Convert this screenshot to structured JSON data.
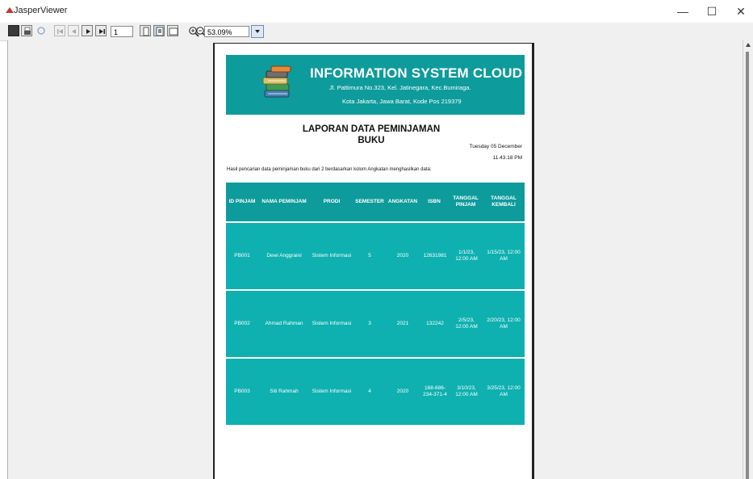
{
  "window": {
    "title": "JasperViewer",
    "minimize_glyph": "—",
    "maximize_glyph": "☐",
    "close_glyph": "✕"
  },
  "toolbar": {
    "page_number": "1",
    "zoom_value": "53.09%",
    "icons": [
      "save-icon",
      "print-icon",
      "reload-icon",
      "first-page-icon",
      "previous-page-icon",
      "next-page-icon",
      "last-page-icon",
      "actual-size-icon",
      "fit-page-icon",
      "fit-width-icon",
      "zoom-in-icon",
      "zoom-out-icon",
      "zoom-dropdown-icon"
    ]
  },
  "report": {
    "company": "INFORMATION SYSTEM CLOUD",
    "address_line1": "Jl. Pattimura No.323, Kel. Jatinegara, Kec.Bumiraga.",
    "address_line2": "Kota Jakarta, Jawa Barat, Kode Pos 219379",
    "title_line1": "LAPORAN DATA PEMINJAMAN",
    "title_line2": "BUKU",
    "date": "Tuesday 05 December",
    "time": "11.43.18 PM",
    "description": "Hasil pencarian data peminjaman buku dari 2 berdasarkan kolom Angkatan menghasilkan data:"
  },
  "table": {
    "headers": [
      "ID PINJAM",
      "NAMA PEMINJAM",
      "PRODI",
      "SEMESTER",
      "ANGKATAN",
      "ISBN",
      "TANGGAL PINJAM",
      "TANGGAL KEMBALI"
    ],
    "rows": [
      [
        "PB001",
        "Dewi Anggraini",
        "Sistem Informasi",
        "5",
        "2020",
        "12631981",
        "1/1/23, 12:00 AM",
        "1/15/23, 12:00 AM"
      ],
      [
        "PB002",
        "Ahmad Rahman",
        "Sistem Informasi",
        "3",
        "2021",
        "132242",
        "2/5/23, 12:00 AM",
        "2/20/23, 12:00 AM"
      ],
      [
        "PB003",
        "Siti Rahmah",
        "Sistem Informasi",
        "4",
        "2020",
        "168-686-234-371-4",
        "3/10/23, 12:00 AM",
        "3/25/23, 12:00 AM"
      ]
    ]
  },
  "colors": {
    "header_teal": "#0e9b9b",
    "row_teal": "#0fb0b0"
  }
}
